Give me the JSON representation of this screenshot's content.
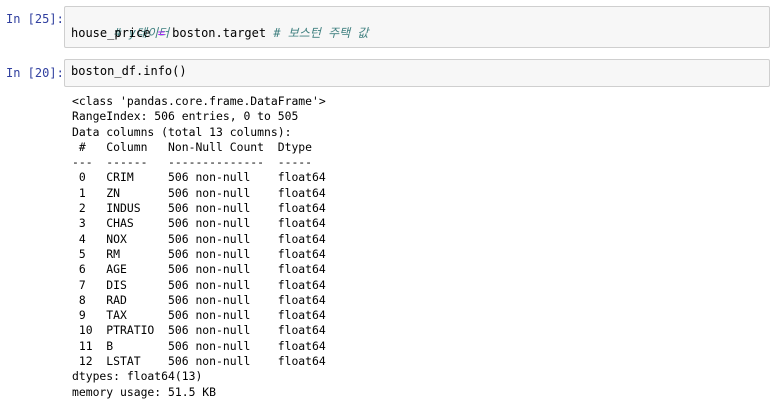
{
  "cells": [
    {
      "prompt": "In [25]:",
      "lines": [
        {
          "comment": "# y데이터"
        },
        {
          "var": "house_price",
          "op": " = ",
          "expr": "boston.target",
          "comment": " # 보스턴 주택 값"
        }
      ]
    },
    {
      "prompt": "In [20]:",
      "lines": [
        {
          "expr": "boston_df.info()"
        }
      ],
      "output": [
        "<class 'pandas.core.frame.DataFrame'>",
        "RangeIndex: 506 entries, 0 to 505",
        "Data columns (total 13 columns):",
        " #   Column   Non-Null Count  Dtype  ",
        "---  ------   --------------  -----  ",
        " 0   CRIM     506 non-null    float64",
        " 1   ZN       506 non-null    float64",
        " 2   INDUS    506 non-null    float64",
        " 3   CHAS     506 non-null    float64",
        " 4   NOX      506 non-null    float64",
        " 5   RM       506 non-null    float64",
        " 6   AGE      506 non-null    float64",
        " 7   DIS      506 non-null    float64",
        " 8   RAD      506 non-null    float64",
        " 9   TAX      506 non-null    float64",
        " 10  PTRATIO  506 non-null    float64",
        " 11  B        506 non-null    float64",
        " 12  LSTAT    506 non-null    float64",
        "dtypes: float64(13)",
        "memory usage: 51.5 KB"
      ]
    }
  ]
}
